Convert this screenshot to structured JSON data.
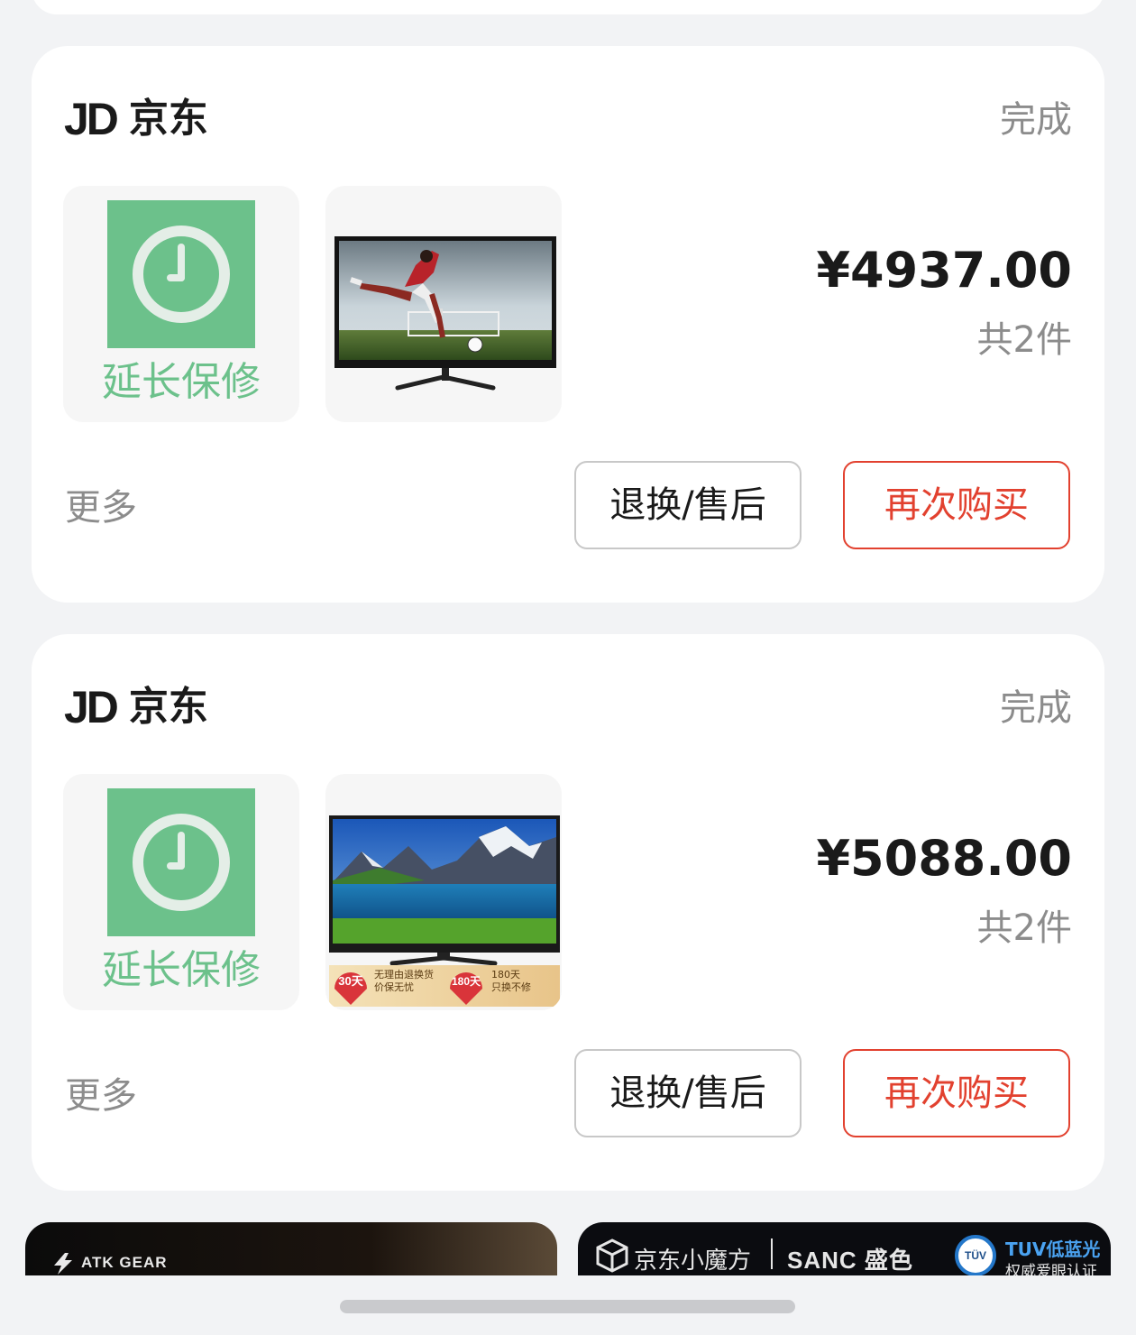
{
  "orders": [
    {
      "shop": {
        "logo": "JD",
        "name": "京东"
      },
      "status": "完成",
      "items": [
        {
          "type": "warranty",
          "label": "延长保修",
          "icon": "clock-icon"
        },
        {
          "type": "product",
          "icon": "tv-soccer-image"
        }
      ],
      "price": "¥4937.00",
      "count": "共2件",
      "more_label": "更多",
      "return_label": "退换/售后",
      "rebuy_label": "再次购买"
    },
    {
      "shop": {
        "logo": "JD",
        "name": "京东"
      },
      "status": "完成",
      "items": [
        {
          "type": "warranty",
          "label": "延长保修",
          "icon": "clock-icon"
        },
        {
          "type": "product",
          "icon": "tv-landscape-image",
          "promo": {
            "badge1": "30天",
            "text1_line1": "无理由退换货",
            "text1_line2": "价保无忧",
            "badge2": "180天",
            "text2_line1": "180天",
            "text2_line2": "只换不修"
          }
        }
      ],
      "price": "¥5088.00",
      "count": "共2件",
      "more_label": "更多",
      "return_label": "退换/售后",
      "rebuy_label": "再次购买"
    }
  ],
  "banners": {
    "left": {
      "brand": "ATK GEAR"
    },
    "right": {
      "brand1": "京东小魔方",
      "brand2": "SANC 盛色",
      "badge": "TÜV",
      "cert_title": "TUV低蓝光",
      "cert_sub": "权威爱眼认证"
    }
  },
  "colors": {
    "accent_red": "#e2412f",
    "warranty_green": "#6cc18b",
    "muted_text": "#8c8c8c",
    "background": "#f2f3f5"
  }
}
